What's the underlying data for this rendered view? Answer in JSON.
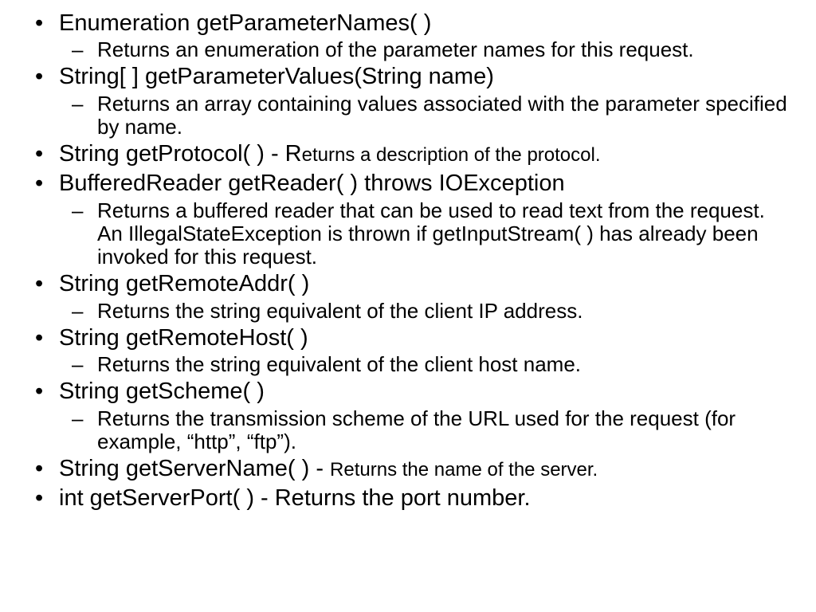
{
  "items": [
    {
      "main": "Enumeration getParameterNames( )",
      "tail": "",
      "subs": [
        "Returns an enumeration of the parameter names for this request."
      ]
    },
    {
      "main": "String[ ] getParameterValues(String name)",
      "tail": "",
      "subs": [
        "Returns an array containing values associated with the parameter specified by name."
      ]
    },
    {
      "main": "String getProtocol( ) - R",
      "tail": "eturns a description of the protocol.",
      "subs": []
    },
    {
      "main": "BufferedReader getReader( ) throws IOException",
      "tail": "",
      "subs": [
        "Returns a buffered reader that can be used to read text from the request. An IllegalStateException is thrown if getInputStream( ) has already been invoked for this request."
      ]
    },
    {
      "main": "String getRemoteAddr( )",
      "tail": "",
      "subs": [
        "Returns the string equivalent of the client IP address."
      ]
    },
    {
      "main": "String getRemoteHost( )",
      "tail": "",
      "subs": [
        "Returns the string equivalent of the client host name."
      ]
    },
    {
      "main": "String getScheme( )",
      "tail": "",
      "subs": [
        "Returns the transmission scheme of the URL used for the request (for example, “http”, “ftp”)."
      ]
    },
    {
      "main": "String getServerName( ) - ",
      "tail": "Returns the name of the server.",
      "subs": []
    },
    {
      "main": "int getServerPort( ) - Returns the port number.",
      "tail": "",
      "subs": []
    }
  ]
}
